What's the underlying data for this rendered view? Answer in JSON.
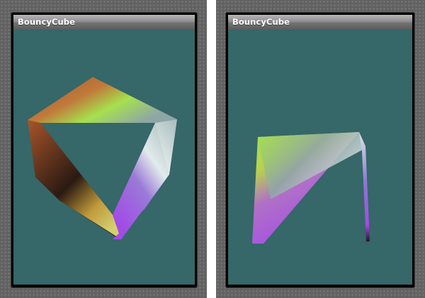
{
  "windows": [
    {
      "id": "left",
      "title": "BouncyCube",
      "colors": {
        "background": "#366769",
        "titlebar_text": "#ffffff",
        "face_green": "#a6e04e",
        "face_purple": "#a24be6",
        "face_orange": "#a8552a",
        "face_gray": "#8fa6a6"
      }
    },
    {
      "id": "right",
      "title": "BouncyCube",
      "colors": {
        "background": "#366769",
        "titlebar_text": "#ffffff",
        "face_green": "#a6e04e",
        "face_purple": "#a24be6",
        "face_gray": "#8fa6a6"
      }
    }
  ]
}
